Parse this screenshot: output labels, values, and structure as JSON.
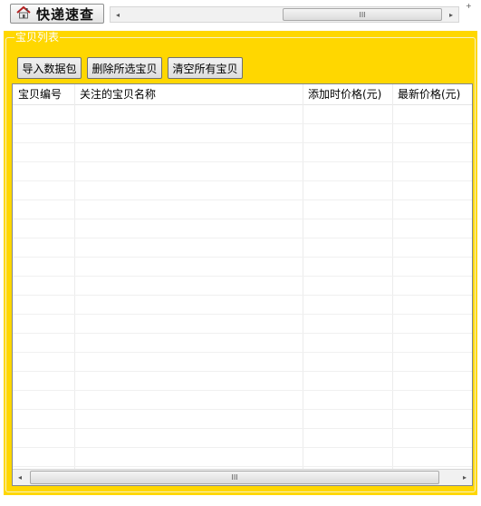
{
  "topbar": {
    "quick_button_label": "快递速查",
    "home_icon": "house-icon",
    "scroll_left_glyph": "◂",
    "scroll_right_glyph": "▸",
    "scroll_grip_glyph": "III"
  },
  "panel": {
    "background": "#ffd700",
    "group_title": "宝贝列表",
    "buttons": {
      "import": "导入数据包",
      "delete_selected": "删除所选宝贝",
      "clear_all": "清空所有宝贝"
    },
    "table": {
      "columns": [
        "宝贝编号",
        "关注的宝贝名称",
        "添加时价格(元)",
        "最新价格(元)"
      ],
      "rows": []
    },
    "scroll_left_glyph": "◂",
    "scroll_right_glyph": "▸",
    "scroll_grip_glyph": "III"
  }
}
